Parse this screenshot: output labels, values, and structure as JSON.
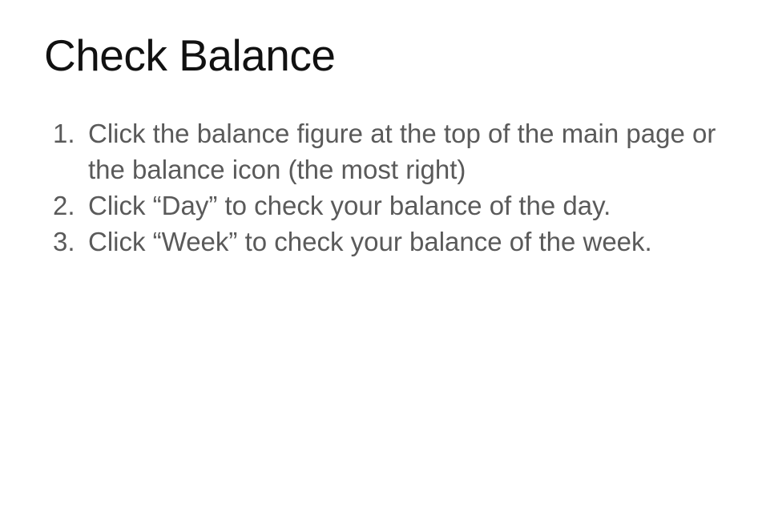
{
  "slide": {
    "title": "Check Balance",
    "steps": [
      {
        "number": "1.",
        "text": "Click the balance figure at the top of the main page or the balance icon (the most right)"
      },
      {
        "number": "2.",
        "text": "Click “Day” to check your balance of the day."
      },
      {
        "number": "3.",
        "text": "Click “Week” to check your balance of the week."
      }
    ]
  },
  "colors": {
    "title": "#111111",
    "body_text": "#5a5a5a",
    "background": "#ffffff"
  }
}
